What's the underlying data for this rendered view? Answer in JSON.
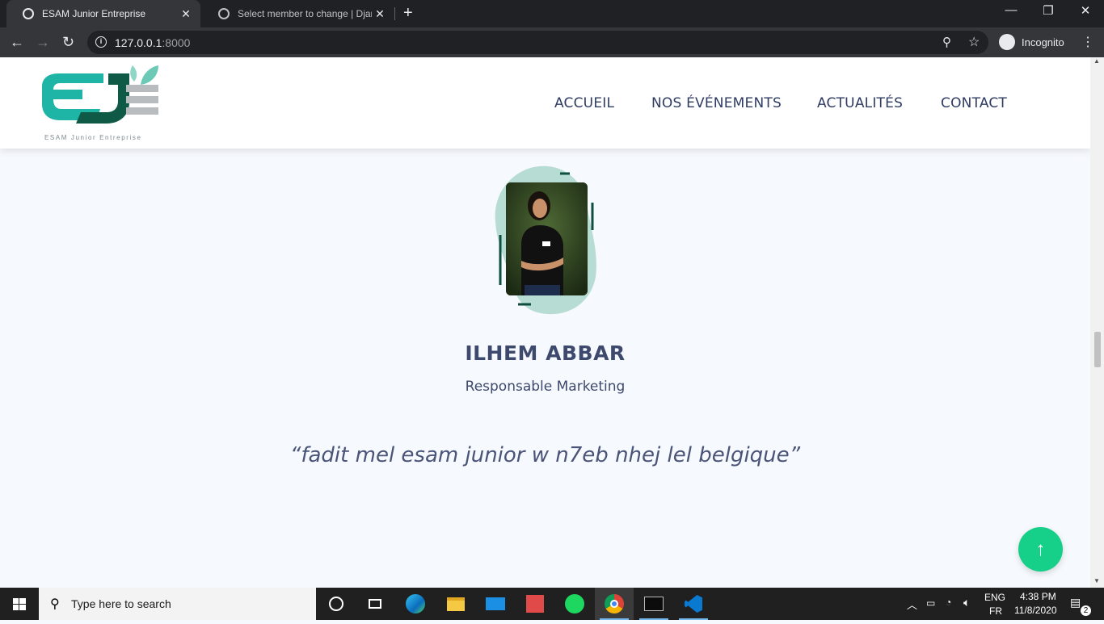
{
  "browser": {
    "tabs": [
      {
        "title": "ESAM Junior Entreprise",
        "active": true
      },
      {
        "title": "Select member to change | Djang",
        "active": false
      }
    ],
    "url_host": "127.0.0.1",
    "url_port": ":8000",
    "incognito_label": "Incognito"
  },
  "site": {
    "logo_caption": "ESAM Junior Entreprise",
    "nav": [
      "ACCUEIL",
      "NOS ÉVÉNEMENTS",
      "ACTUALITÉS",
      "CONTACT"
    ]
  },
  "member": {
    "name": "ILHEM ABBAR",
    "role": "Responsable Marketing",
    "quote": "“fadit mel esam junior w n7eb nhej lel belgique”"
  },
  "colors": {
    "brand_teal": "#1fb5a6",
    "brand_dark_green": "#0f5a47",
    "blob": "#b7dcd4",
    "scroll_top_button": "#16cf88",
    "text_navy": "#3e4a6d"
  },
  "taskbar": {
    "search_placeholder": "Type here to search",
    "lang_top": "ENG",
    "lang_bottom": "FR",
    "time": "4:38 PM",
    "date": "11/8/2020",
    "notifications": "2"
  }
}
